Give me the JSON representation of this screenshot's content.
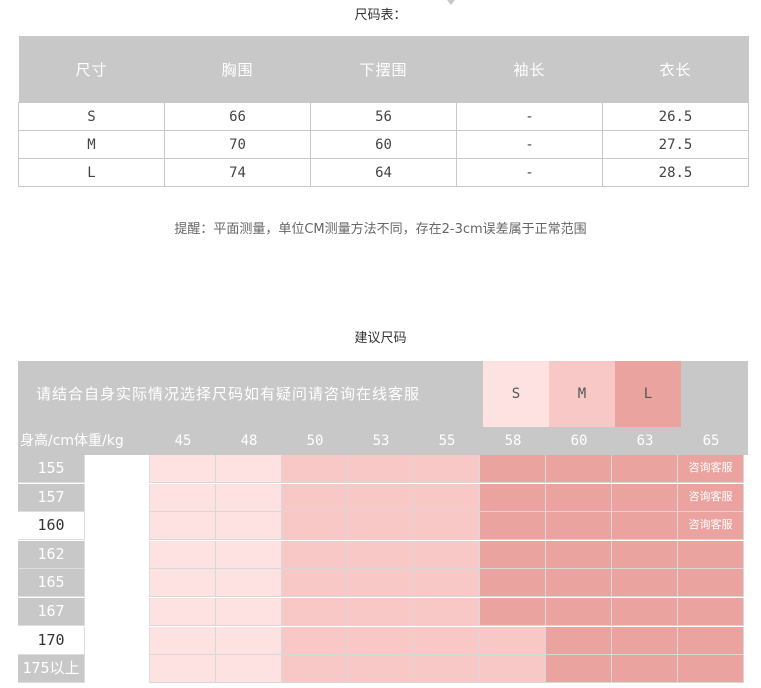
{
  "size_chart": {
    "title": "尺码表：",
    "headers": [
      "尺寸",
      "胸围",
      "下摆围",
      "袖长",
      "衣长"
    ],
    "rows": [
      [
        "S",
        "66",
        "56",
        "-",
        "26.5"
      ],
      [
        "M",
        "70",
        "60",
        "-",
        "27.5"
      ],
      [
        "L",
        "74",
        "64",
        "-",
        "28.5"
      ]
    ],
    "note": "提醒：平面测量，单位CM测量方法不同，存在2-3cm误差属于正常范围"
  },
  "recommend": {
    "title": "建议尺码",
    "banner_text": "请结合自身实际情况选择尺码如有疑问请咨询在线客服",
    "legend": [
      {
        "label": "S",
        "color": "#fde2e1"
      },
      {
        "label": "M",
        "color": "#f8c8c6"
      },
      {
        "label": "L",
        "color": "#eaa39f"
      }
    ],
    "axis_label": "身高/cm体重/kg",
    "weights": [
      "45",
      "48",
      "50",
      "53",
      "55",
      "58",
      "60",
      "63",
      "65"
    ],
    "consult_text": "咨询客服",
    "rows": [
      {
        "height": "155",
        "shade": "dark",
        "sizes": [
          "S",
          "S",
          "M",
          "M",
          "M",
          "L",
          "L",
          "L",
          "X"
        ]
      },
      {
        "height": "157",
        "shade": "dark",
        "sizes": [
          "S",
          "S",
          "M",
          "M",
          "M",
          "L",
          "L",
          "L",
          "X"
        ]
      },
      {
        "height": "160",
        "shade": "light",
        "sizes": [
          "S",
          "S",
          "M",
          "M",
          "M",
          "L",
          "L",
          "L",
          "X"
        ]
      },
      {
        "height": "162",
        "shade": "dark",
        "sizes": [
          "S",
          "S",
          "M",
          "M",
          "M",
          "L",
          "L",
          "L",
          "L"
        ]
      },
      {
        "height": "165",
        "shade": "dark",
        "sizes": [
          "S",
          "S",
          "M",
          "M",
          "M",
          "L",
          "L",
          "L",
          "L"
        ]
      },
      {
        "height": "167",
        "shade": "dark",
        "sizes": [
          "S",
          "S",
          "M",
          "M",
          "M",
          "L",
          "L",
          "L",
          "L"
        ]
      },
      {
        "height": "170",
        "shade": "light",
        "sizes": [
          "S",
          "S",
          "M",
          "M",
          "M",
          "M",
          "L",
          "L",
          "L"
        ]
      },
      {
        "height": "175以上",
        "shade": "dark",
        "sizes": [
          "S",
          "S",
          "M",
          "M",
          "M",
          "M",
          "L",
          "L",
          "L"
        ]
      }
    ]
  }
}
